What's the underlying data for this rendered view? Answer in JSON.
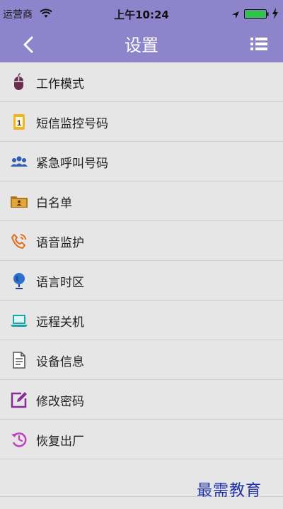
{
  "status_bar": {
    "carrier": "运营商",
    "time": "上午10:24"
  },
  "nav": {
    "title": "设置"
  },
  "menu_items": [
    {
      "label": "工作模式",
      "icon": "mouse-icon",
      "color": "#6b2d4e"
    },
    {
      "label": "短信监控号码",
      "icon": "sim-card-icon",
      "color": "#e0a21a"
    },
    {
      "label": "紧急呼叫号码",
      "icon": "contacts-group-icon",
      "color": "#2f5fb3"
    },
    {
      "label": "白名单",
      "icon": "folder-contact-icon",
      "color": "#b07a1c"
    },
    {
      "label": "语音监护",
      "icon": "phone-call-icon",
      "color": "#e07020"
    },
    {
      "label": "语言时区",
      "icon": "globe-icon",
      "color": "#2e6fd0"
    },
    {
      "label": "远程关机",
      "icon": "laptop-icon",
      "color": "#1aa5a5"
    },
    {
      "label": "设备信息",
      "icon": "document-icon",
      "color": "#666666"
    },
    {
      "label": "修改密码",
      "icon": "edit-icon",
      "color": "#8a2b9a"
    },
    {
      "label": "恢复出厂",
      "icon": "history-icon",
      "color": "#c040c0"
    }
  ],
  "watermark": "最需教育",
  "colors": {
    "header": "#8d84cc",
    "background": "#e6e6e6"
  }
}
